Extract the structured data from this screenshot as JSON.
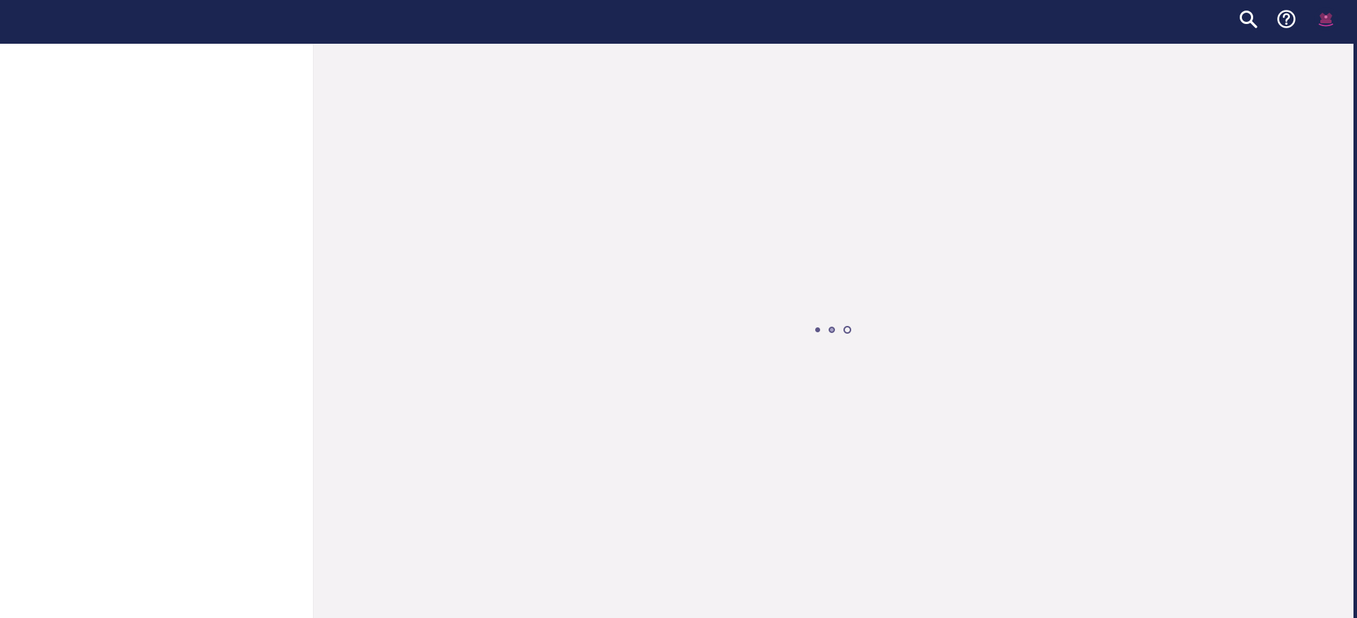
{
  "topbar": {
    "background": "#1b2551",
    "actions": [
      {
        "icon": "search-icon"
      },
      {
        "icon": "help-icon"
      },
      {
        "icon": "avatar"
      }
    ]
  },
  "main": {
    "background": "#f4f2f4",
    "state": "loading",
    "loader_dots": 3,
    "loader_color": "#5d5788"
  },
  "sidebar": {
    "background": "#ffffff"
  }
}
